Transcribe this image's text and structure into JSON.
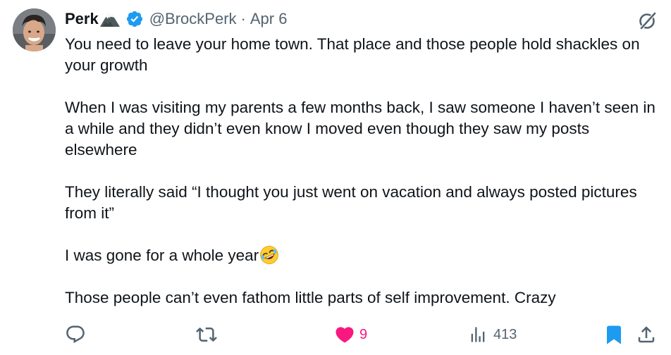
{
  "tweet": {
    "author_name": "Perk",
    "handle": "@BrockPerk",
    "separator": "·",
    "date": "Apr 6",
    "paragraphs": [
      "You need to leave your home town. That place and those people hold shackles on your growth",
      "When I was visiting my parents a few months back, I saw someone I haven’t seen in a while and they didn’t even know I moved even though they saw my posts elsewhere",
      "They literally said “I thought you just went on vacation and always posted pictures from it”",
      "I was gone for a whole year",
      "Those people can’t even fathom little parts of self improvement. Crazy"
    ]
  },
  "actions": {
    "likes": "9",
    "views": "413"
  },
  "icons": {
    "name_emoji": "mountain-icon",
    "verified": "verified-badge-icon",
    "grok": "grok-icon",
    "emoji_in_text": "rolling-on-floor-laughing-emoji",
    "reply": "reply-icon",
    "retweet": "retweet-icon",
    "like": "heart-icon",
    "views": "views-icon",
    "bookmark": "bookmark-icon",
    "share": "share-icon"
  },
  "colors": {
    "text": "#0f1419",
    "secondary": "#536471",
    "verified": "#1d9bf0",
    "like": "#f91880",
    "bookmark": "#1d9bf0"
  }
}
